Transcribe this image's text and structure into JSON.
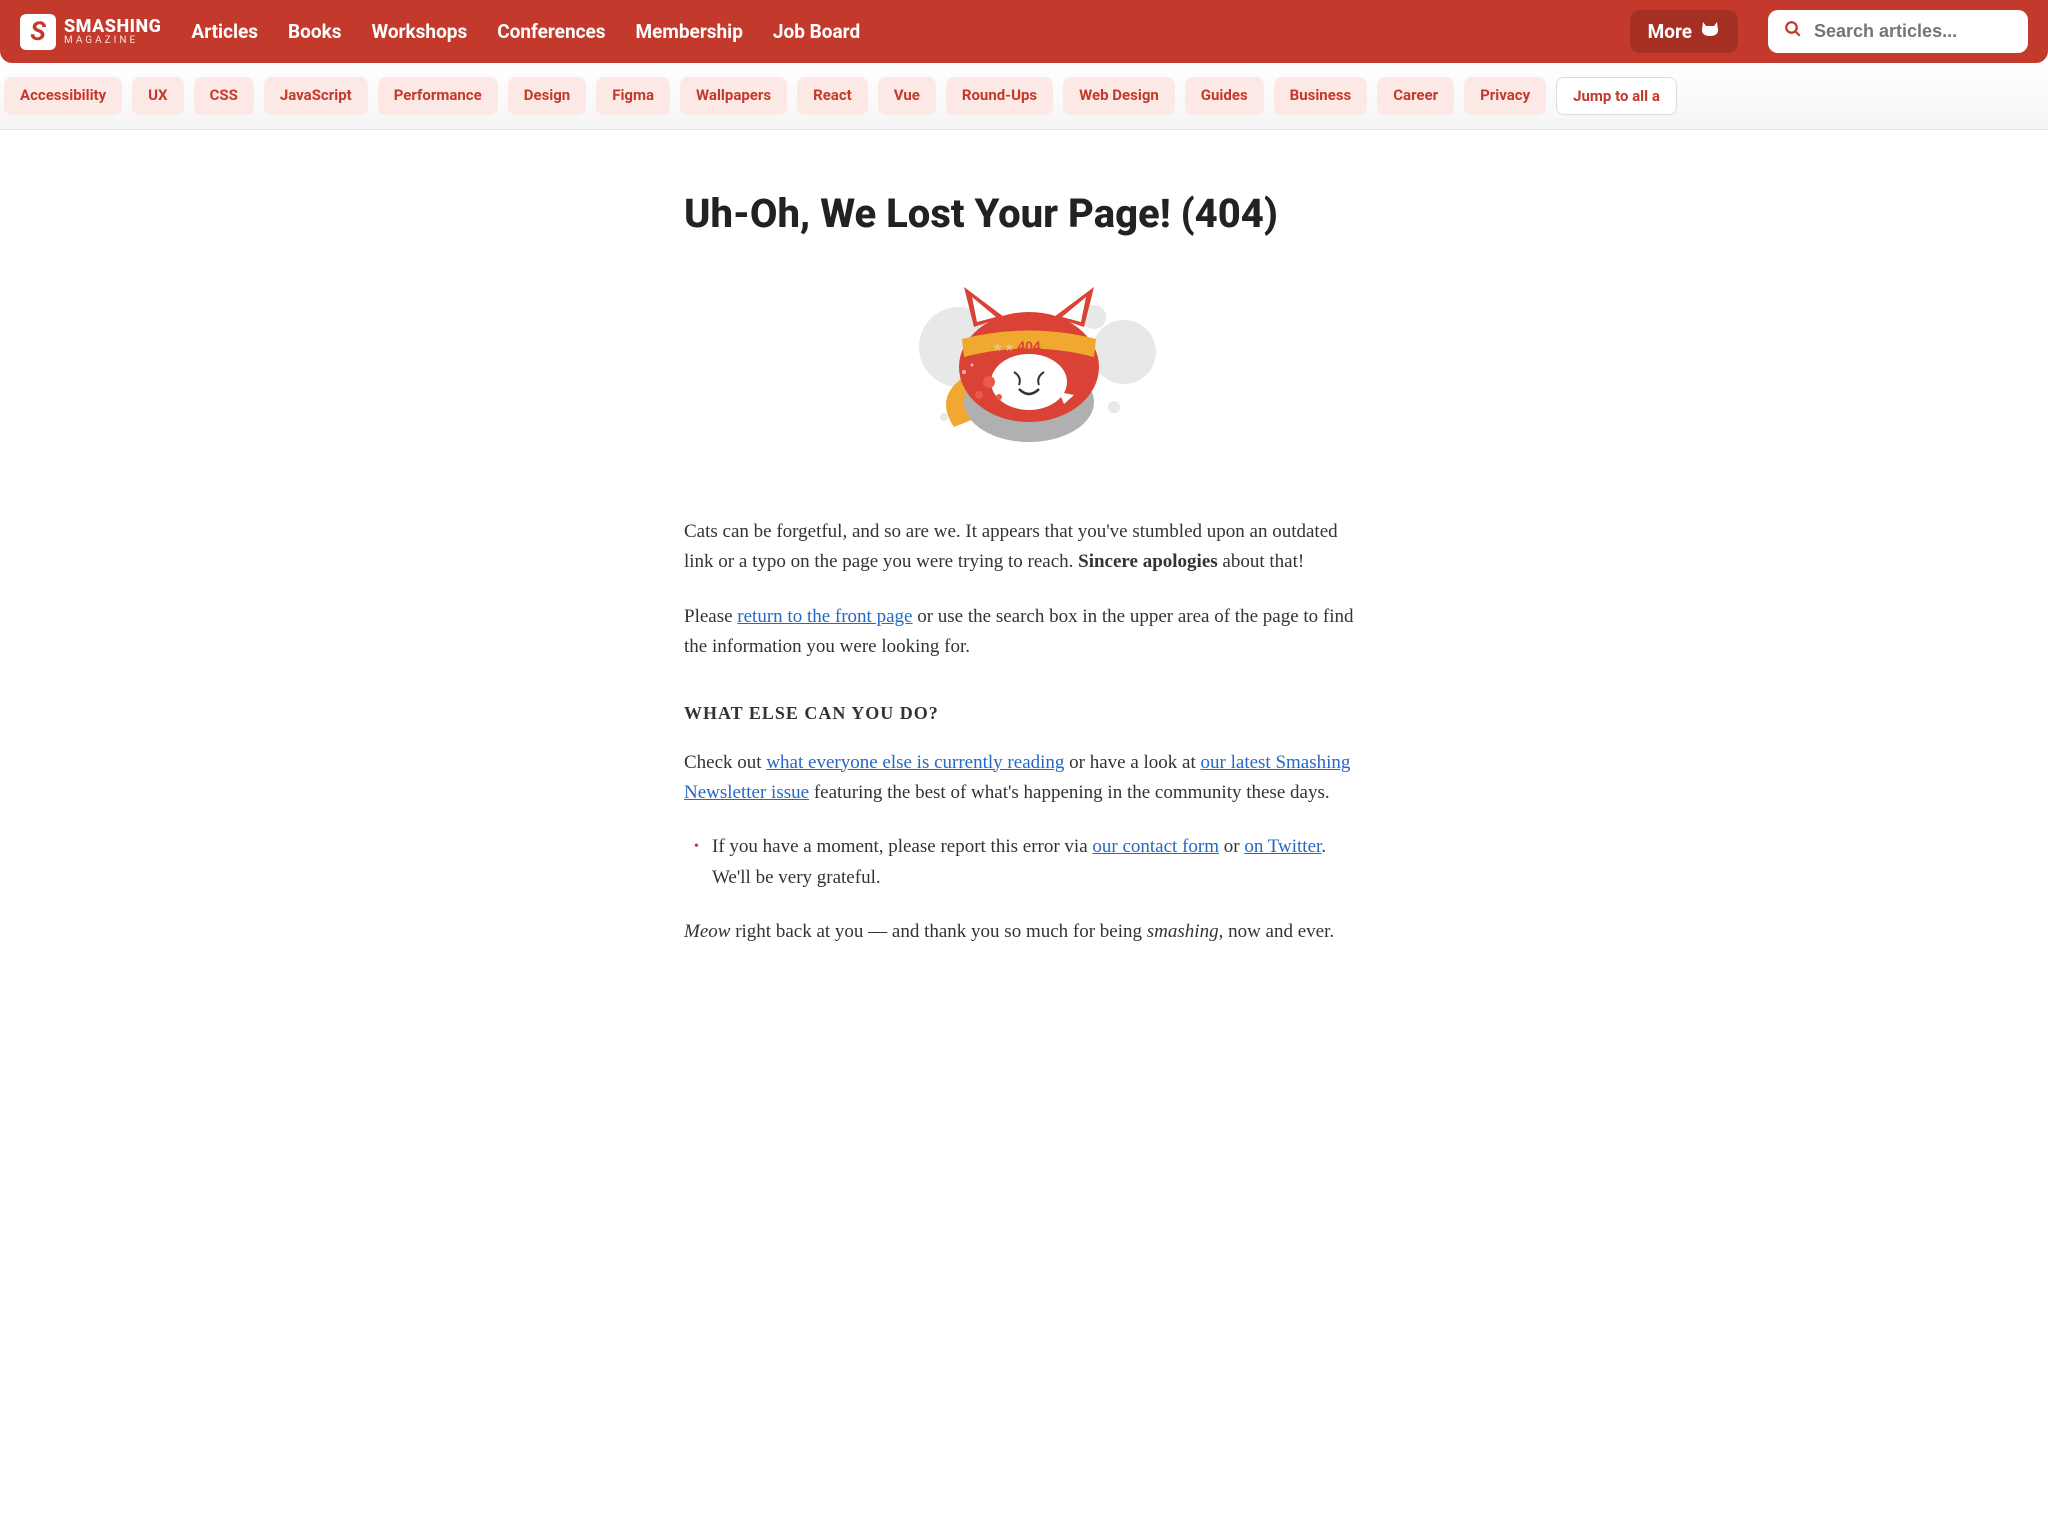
{
  "logo": {
    "title": "SMASHING",
    "subtitle": "MAGAZINE"
  },
  "nav": {
    "items": [
      "Articles",
      "Books",
      "Workshops",
      "Conferences",
      "Membership",
      "Job Board"
    ],
    "more": "More"
  },
  "search": {
    "placeholder": "Search articles..."
  },
  "tags": [
    "Accessibility",
    "UX",
    "CSS",
    "JavaScript",
    "Performance",
    "Design",
    "Figma",
    "Wallpapers",
    "React",
    "Vue",
    "Round-Ups",
    "Web Design",
    "Guides",
    "Business",
    "Career",
    "Privacy"
  ],
  "jump_label": "Jump to all a",
  "page": {
    "title": "Uh-Oh, We Lost Your Page! (404)",
    "p1_a": "Cats can be forgetful, and so are we. It appears that you've stumbled upon an outdated link or a typo on the page you were trying to reach. ",
    "p1_b": "Sincere apologies",
    "p1_c": " about that!",
    "p2_a": "Please ",
    "p2_link": "return to the front page",
    "p2_b": " or use the search box in the upper area of the page to find the information you were looking for.",
    "h2": "WHAT ELSE CAN YOU DO?",
    "p3_a": "Check out ",
    "p3_link1": "what everyone else is currently reading",
    "p3_b": " or have a look at ",
    "p3_link2": "our latest Smashing Newsletter issue",
    "p3_c": " featuring the best of what's happening in the community these days.",
    "li_a": "If you have a moment, please report this error via ",
    "li_link1": "our contact form",
    "li_b": " or ",
    "li_link2": "on Twitter",
    "li_c": ". We'll be very grateful.",
    "p4_a": "Meow",
    "p4_b": " right back at you — and thank you so much for being ",
    "p4_c": "smashing",
    "p4_d": ", now and ever."
  }
}
